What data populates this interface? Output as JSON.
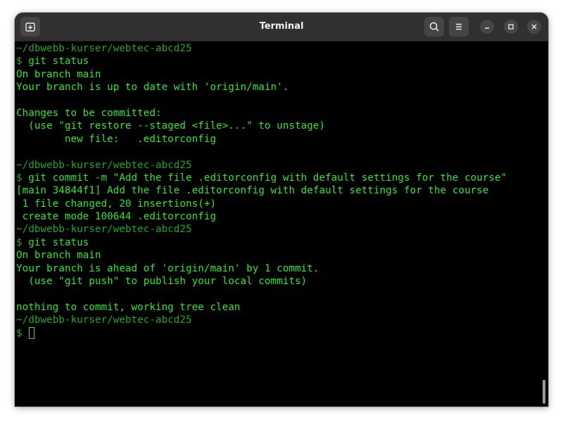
{
  "window": {
    "title": "Terminal"
  },
  "icons": {
    "new_tab": "new-tab-icon",
    "search": "search-icon",
    "menu": "hamburger-menu-icon",
    "minimize": "minimize-icon",
    "maximize": "maximize-icon",
    "close": "close-icon"
  },
  "colors": {
    "terminal_background": "#000000",
    "text_green": "#2ee62e",
    "prompt_green": "#23a523",
    "titlebar": "#303030"
  },
  "terminal": {
    "lines": [
      {
        "kind": "path",
        "text": "~/dbwebb-kurser/webtec-abcd25"
      },
      {
        "kind": "prompt",
        "dollar": "$",
        "text": " git status"
      },
      {
        "kind": "output",
        "text": "On branch main"
      },
      {
        "kind": "output",
        "text": "Your branch is up to date with 'origin/main'."
      },
      {
        "kind": "empty",
        "text": ""
      },
      {
        "kind": "output",
        "text": "Changes to be committed:"
      },
      {
        "kind": "output",
        "text": "  (use \"git restore --staged <file>...\" to unstage)"
      },
      {
        "kind": "output",
        "text": "        new file:   .editorconfig"
      },
      {
        "kind": "empty",
        "text": ""
      },
      {
        "kind": "path",
        "text": "~/dbwebb-kurser/webtec-abcd25"
      },
      {
        "kind": "prompt",
        "dollar": "$",
        "text": " git commit -m \"Add the file .editorconfig with default settings for the course\""
      },
      {
        "kind": "output",
        "text": "[main 34844f1] Add the file .editorconfig with default settings for the course"
      },
      {
        "kind": "output",
        "text": " 1 file changed, 20 insertions(+)"
      },
      {
        "kind": "output",
        "text": " create mode 100644 .editorconfig"
      },
      {
        "kind": "path",
        "text": "~/dbwebb-kurser/webtec-abcd25"
      },
      {
        "kind": "prompt",
        "dollar": "$",
        "text": " git status"
      },
      {
        "kind": "output",
        "text": "On branch main"
      },
      {
        "kind": "output",
        "text": "Your branch is ahead of 'origin/main' by 1 commit."
      },
      {
        "kind": "output",
        "text": "  (use \"git push\" to publish your local commits)"
      },
      {
        "kind": "empty",
        "text": ""
      },
      {
        "kind": "output",
        "text": "nothing to commit, working tree clean"
      },
      {
        "kind": "path",
        "text": "~/dbwebb-kurser/webtec-abcd25"
      },
      {
        "kind": "current-prompt",
        "dollar": "$",
        "text": " "
      }
    ]
  }
}
